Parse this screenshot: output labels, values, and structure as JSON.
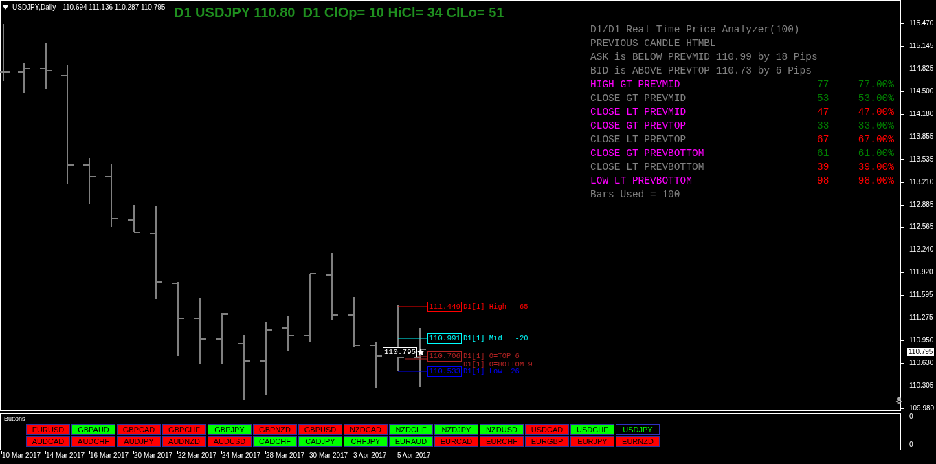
{
  "chart_header": {
    "symbol": "USDJPY,Daily",
    "ohlc": "110.694 111.136 110.287 110.795",
    "headline": "D1 USDJPY 110.80  D1 ClOp= 10 HiCl= 34 ClLo= 51"
  },
  "analyzer": {
    "lines": [
      "D1/D1 Real Time Price Analyzer(100)",
      "PREVIOUS CANDLE HTMBL",
      "ASK is BELOW PREVMID 110.99 by 18 Pips",
      "BID is ABOVE PREVTOP 110.73 by 6 Pips"
    ],
    "stats": [
      {
        "label": "HIGH GT PREVMID",
        "color": "#ff00ff",
        "values": [
          {
            "text": "77",
            "color": "#008000"
          },
          {
            "text": "77.00%",
            "color": "#008000"
          }
        ]
      },
      {
        "label": "CLOSE GT PREVMID",
        "color": "#808080",
        "values": [
          {
            "text": "53",
            "color": "#008000"
          },
          {
            "text": "53.00%",
            "color": "#008000"
          }
        ]
      },
      {
        "label": "CLOSE LT PREVMID",
        "color": "#ff00ff",
        "values": [
          {
            "text": "47",
            "color": "#ff0000"
          },
          {
            "text": "47.00%",
            "color": "#ff0000"
          }
        ]
      },
      {
        "label": "CLOSE GT PREVTOP",
        "color": "#ff00ff",
        "values": [
          {
            "text": "33",
            "color": "#008000"
          },
          {
            "text": "33.00%",
            "color": "#008000"
          }
        ]
      },
      {
        "label": "CLOSE LT PREVTOP",
        "color": "#808080",
        "values": [
          {
            "text": "67",
            "color": "#ff0000"
          },
          {
            "text": "67.00%",
            "color": "#ff0000"
          }
        ]
      },
      {
        "label": "CLOSE GT PREVBOTTOM",
        "color": "#ff00ff",
        "values": [
          {
            "text": "61",
            "color": "#008000"
          },
          {
            "text": "61.00%",
            "color": "#008000"
          }
        ]
      },
      {
        "label": "CLOSE LT PREVBOTTOM",
        "color": "#808080",
        "values": [
          {
            "text": "39",
            "color": "#ff0000"
          },
          {
            "text": "39.00%",
            "color": "#ff0000"
          }
        ]
      },
      {
        "label": "LOW LT PREVBOTTOM",
        "color": "#ff00ff",
        "values": [
          {
            "text": "98",
            "color": "#ff0000"
          },
          {
            "text": "98.00%",
            "color": "#ff0000"
          }
        ]
      }
    ],
    "footer": "Bars Used = 100"
  },
  "levels": [
    {
      "price": "111.449",
      "label": "D1[1] High  -65",
      "color": "#ff0000"
    },
    {
      "price": "110.991",
      "label": "D1[1] Mid   -20",
      "color": "#00ffff"
    },
    {
      "price": "110.706",
      "label": "D1[1] O=TOP 6",
      "color": "#b22222"
    },
    {
      "label": "D1[1] O=BOTTOM 9",
      "color": "#b22222"
    },
    {
      "price": "110.533",
      "label": "D1[1] Low  26",
      "color": "#0000ff"
    }
  ],
  "current_price_tag": "110.795",
  "price_axis": {
    "ticks": [
      "115.470",
      "115.145",
      "114.825",
      "114.500",
      "114.180",
      "113.855",
      "113.535",
      "113.210",
      "112.885",
      "112.565",
      "112.240",
      "111.920",
      "111.595",
      "111.275",
      "110.950",
      "110.630",
      "110.305",
      "109.980"
    ],
    "current": "110.795"
  },
  "buttons_panel": {
    "title": "Buttons",
    "axis": [
      "0",
      "0"
    ],
    "rows": [
      [
        {
          "label": "EURUSD",
          "color": "#ff0000",
          "selected": false
        },
        {
          "label": "GBPAUD",
          "color": "#00ff00",
          "selected": false
        },
        {
          "label": "GBPCAD",
          "color": "#ff0000",
          "selected": false
        },
        {
          "label": "GBPCHF",
          "color": "#ff0000",
          "selected": false
        },
        {
          "label": "GBPJPY",
          "color": "#00ff00",
          "selected": false
        },
        {
          "label": "GBPNZD",
          "color": "#ff0000",
          "selected": false
        },
        {
          "label": "GBPUSD",
          "color": "#ff0000",
          "selected": false
        },
        {
          "label": "NZDCAD",
          "color": "#ff0000",
          "selected": false
        },
        {
          "label": "NZDCHF",
          "color": "#00ff00",
          "selected": false
        },
        {
          "label": "NZDJPY",
          "color": "#00ff00",
          "selected": false
        },
        {
          "label": "NZDUSD",
          "color": "#00ff00",
          "selected": false
        },
        {
          "label": "USDCAD",
          "color": "#ff0000",
          "selected": false
        },
        {
          "label": "USDCHF",
          "color": "#00ff00",
          "selected": false
        },
        {
          "label": "USDJPY",
          "color": "#00ff00",
          "selected": true
        }
      ],
      [
        {
          "label": "AUDCAD",
          "color": "#ff0000",
          "selected": false
        },
        {
          "label": "AUDCHF",
          "color": "#ff0000",
          "selected": false
        },
        {
          "label": "AUDJPY",
          "color": "#ff0000",
          "selected": false
        },
        {
          "label": "AUDNZD",
          "color": "#ff0000",
          "selected": false
        },
        {
          "label": "AUDUSD",
          "color": "#ff0000",
          "selected": false
        },
        {
          "label": "CADCHF",
          "color": "#00ff00",
          "selected": false
        },
        {
          "label": "CADJPY",
          "color": "#00ff00",
          "selected": false
        },
        {
          "label": "CHFJPY",
          "color": "#00ff00",
          "selected": false
        },
        {
          "label": "EURAUD",
          "color": "#00ff00",
          "selected": false
        },
        {
          "label": "EURCAD",
          "color": "#ff0000",
          "selected": false
        },
        {
          "label": "EURCHF",
          "color": "#ff0000",
          "selected": false
        },
        {
          "label": "EURGBP",
          "color": "#ff0000",
          "selected": false
        },
        {
          "label": "EURJPY",
          "color": "#ff0000",
          "selected": false
        },
        {
          "label": "EURNZD",
          "color": "#ff0000",
          "selected": false
        }
      ]
    ]
  },
  "date_axis": [
    "10 Mar 2017",
    "14 Mar 2017",
    "16 Mar 2017",
    "20 Mar 2017",
    "22 Mar 2017",
    "24 Mar 2017",
    "28 Mar 2017",
    "30 Mar 2017",
    "3 Apr 2017",
    "5 Apr 2017"
  ]
}
